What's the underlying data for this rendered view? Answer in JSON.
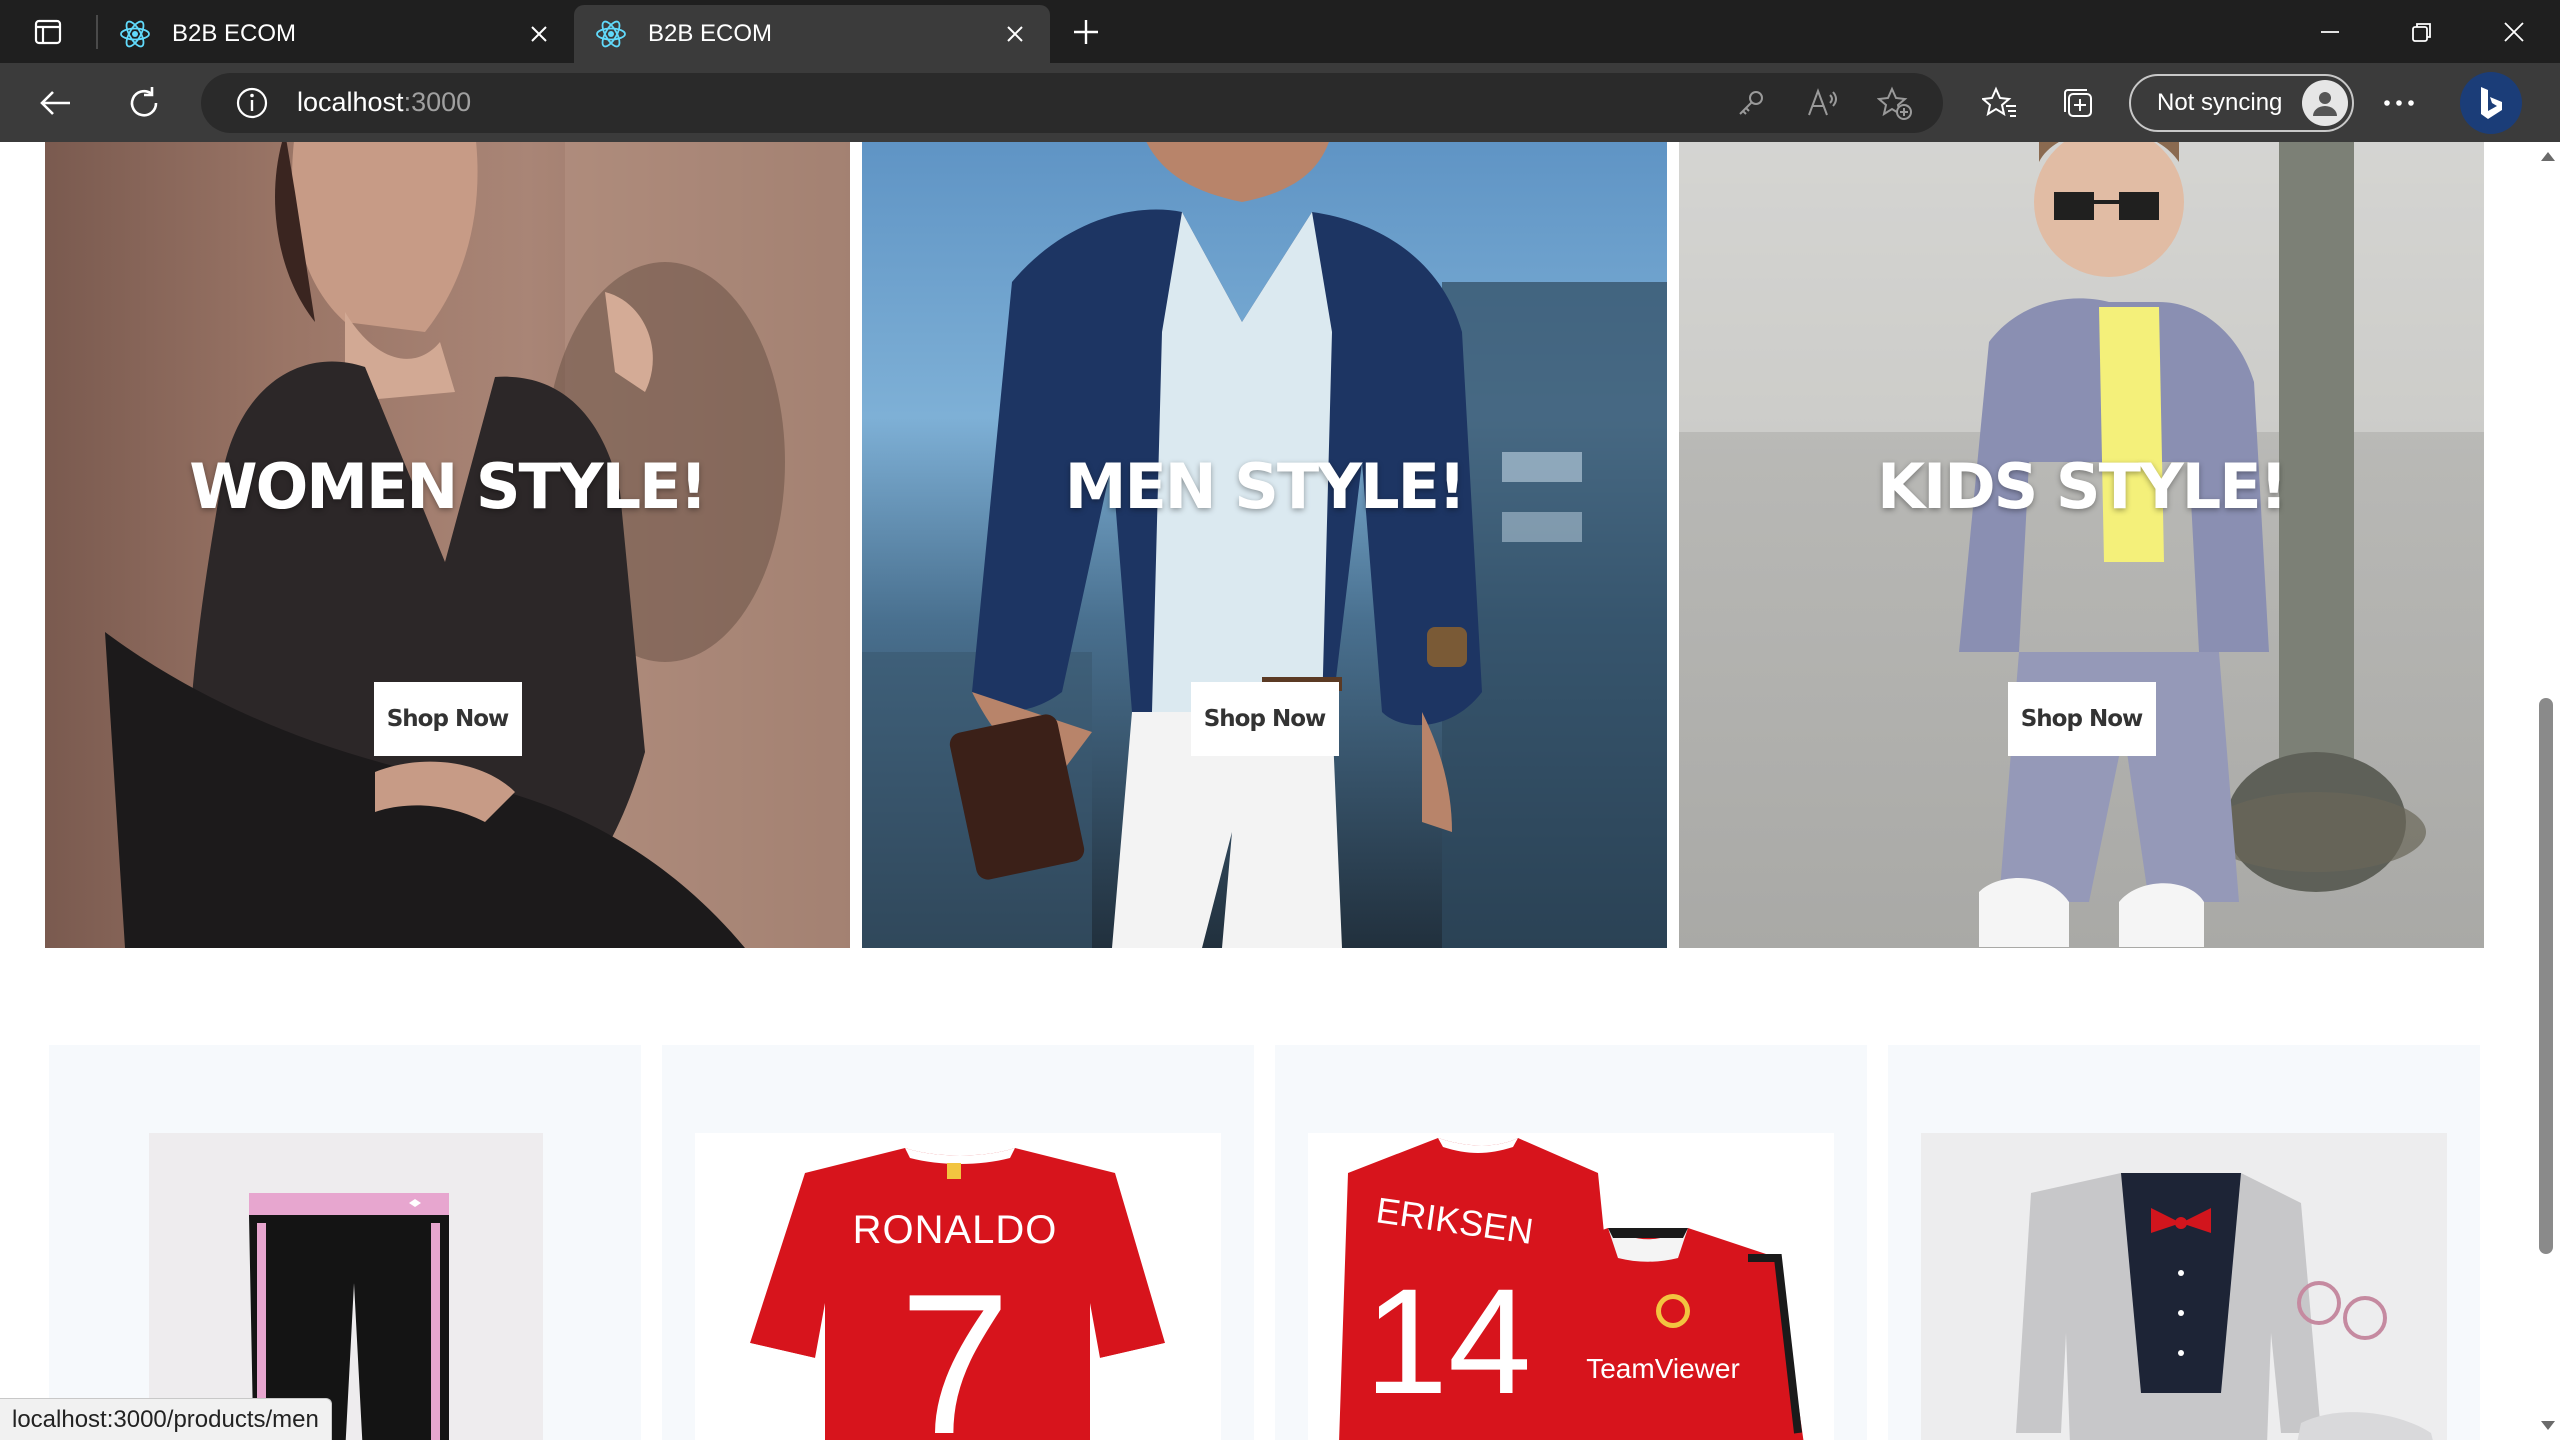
{
  "browser": {
    "tabs": [
      {
        "title": "B2B ECOM",
        "active": false
      },
      {
        "title": "B2B ECOM",
        "active": true
      }
    ],
    "address": {
      "host": "localhost",
      "port": ":3000"
    },
    "sync_label": "Not syncing",
    "status_url": "localhost:3000/products/men"
  },
  "categories": [
    {
      "title": "WOMEN STYLE!",
      "button": "Shop Now"
    },
    {
      "title": "MEN STYLE!",
      "button": "Shop Now"
    },
    {
      "title": "KIDS STYLE!",
      "button": "Shop Now"
    }
  ],
  "products": [
    {
      "name": "kids-track-pants"
    },
    {
      "name": "ronaldo-jersey",
      "print_name": "RONALDO",
      "print_number": "7"
    },
    {
      "name": "eriksen-jersey",
      "print_name": "ERIKSEN",
      "print_number": "14",
      "sponsor": "TeamViewer"
    },
    {
      "name": "kids-suit-set"
    }
  ],
  "colors": {
    "chrome_dark": "#1f1f1f",
    "chrome_toolbar": "#3b3b3b",
    "jersey_red": "#d7141c",
    "card_bg": "#f6f9fc"
  }
}
